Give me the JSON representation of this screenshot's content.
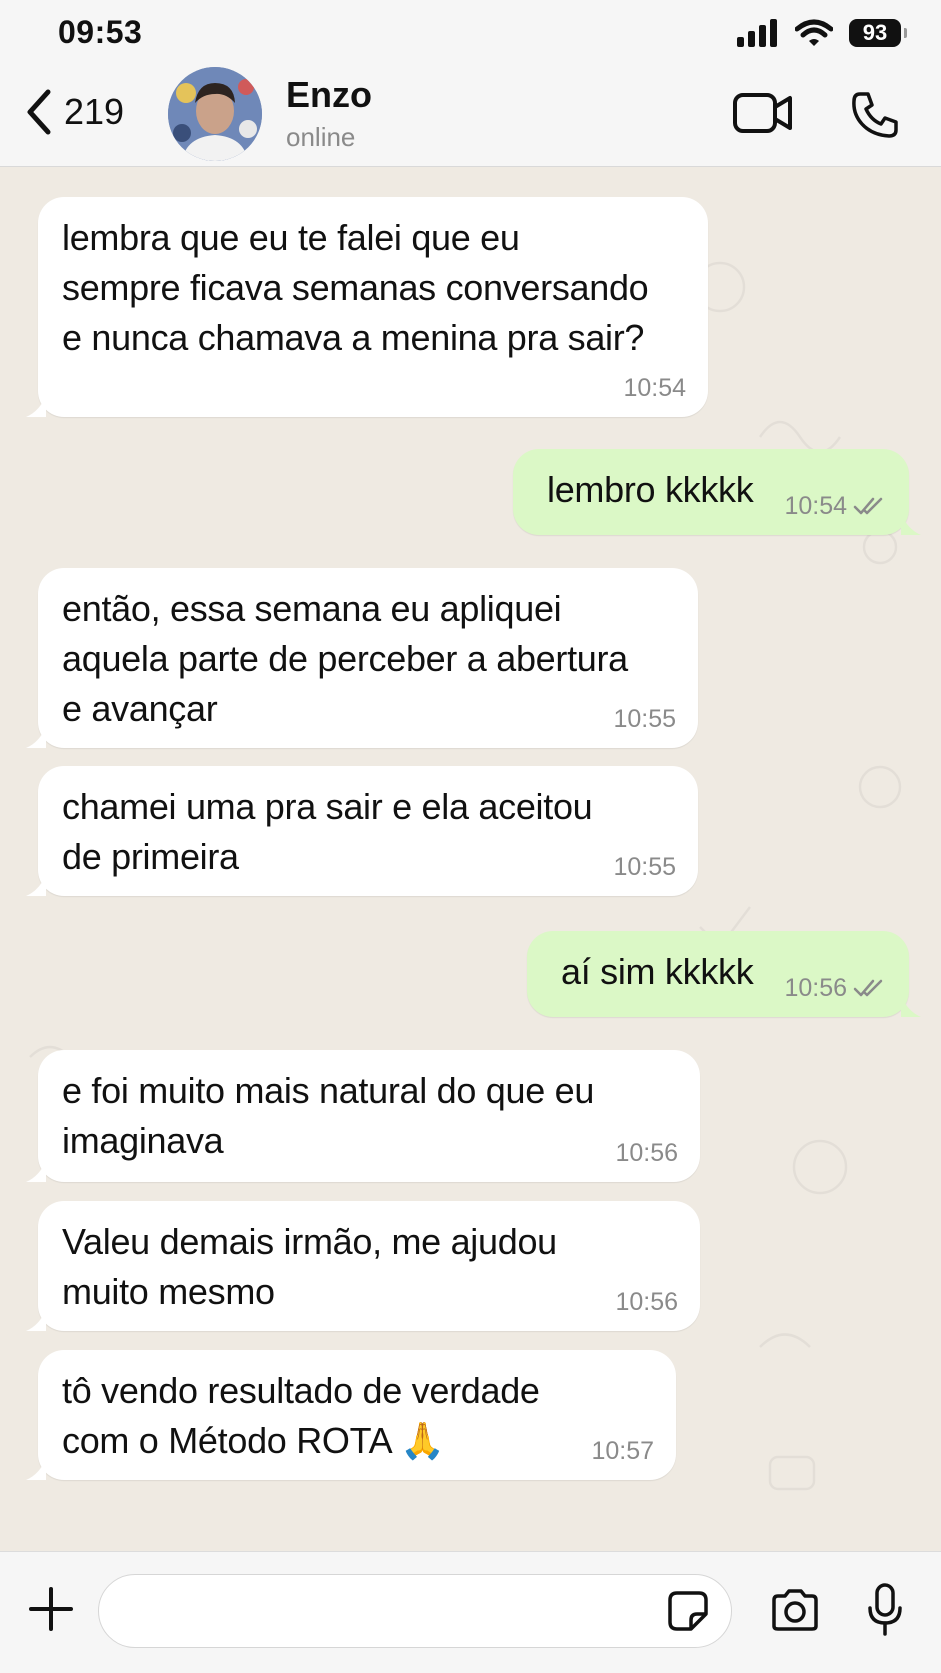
{
  "status_bar": {
    "time": "09:53",
    "battery": "93"
  },
  "header": {
    "back_count": "219",
    "contact_name": "Enzo",
    "contact_status": "online"
  },
  "messages": [
    {
      "direction": "in",
      "text": "lembra que eu te falei que eu\nsempre ficava semanas conversando\ne nunca chamava a menina pra sair?",
      "time": "10:54"
    },
    {
      "direction": "out",
      "text": "lembro kkkkk",
      "time": "10:54",
      "status": "read"
    },
    {
      "direction": "in",
      "text": "então, essa semana eu apliquei\naquela parte de perceber a abertura\ne avançar",
      "time": "10:55"
    },
    {
      "direction": "in",
      "text": "chamei uma pra sair e ela aceitou\nde primeira",
      "time": "10:55"
    },
    {
      "direction": "out",
      "text": "aí sim kkkkk",
      "time": "10:56",
      "status": "read"
    },
    {
      "direction": "in",
      "text": "e foi muito mais natural do que eu\nimaginava",
      "time": "10:56"
    },
    {
      "direction": "in",
      "text": "Valeu demais irmão, me ajudou\nmuito mesmo",
      "time": "10:56"
    },
    {
      "direction": "in",
      "text": "tô vendo resultado de verdade\ncom o Método ROTA 🙏",
      "time": "10:57"
    }
  ],
  "composer": {
    "input_value": "",
    "input_placeholder": ""
  },
  "icons": {
    "back": "chevron-left-icon",
    "video": "video-camera-icon",
    "call": "phone-icon",
    "plus": "plus-icon",
    "sticker": "sticker-icon",
    "camera": "camera-icon",
    "mic": "microphone-icon",
    "read": "double-check-icon",
    "signal": "cellular-signal-icon",
    "wifi": "wifi-icon",
    "battery": "battery-icon"
  },
  "colors": {
    "incoming_bubble": "#ffffff",
    "outgoing_bubble": "#dbf8c6",
    "chat_background": "#efeae2",
    "read_receipt": "#8a8a8a"
  }
}
